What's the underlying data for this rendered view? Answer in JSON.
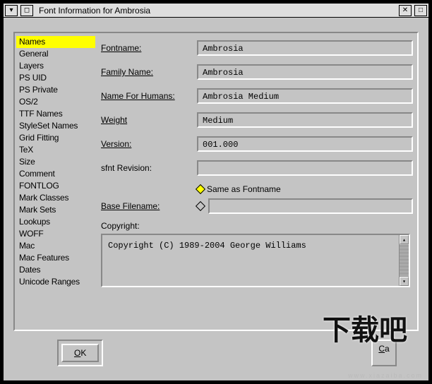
{
  "window": {
    "title": "Font Information for Ambrosia"
  },
  "sidebar": {
    "items": [
      {
        "label": "Names",
        "selected": true
      },
      {
        "label": "General"
      },
      {
        "label": "Layers"
      },
      {
        "label": "PS UID"
      },
      {
        "label": "PS Private"
      },
      {
        "label": "OS/2"
      },
      {
        "label": "TTF Names"
      },
      {
        "label": "StyleSet Names"
      },
      {
        "label": "Grid Fitting"
      },
      {
        "label": "TeX"
      },
      {
        "label": "Size"
      },
      {
        "label": "Comment"
      },
      {
        "label": "FONTLOG"
      },
      {
        "label": "Mark Classes"
      },
      {
        "label": "Mark Sets"
      },
      {
        "label": "Lookups"
      },
      {
        "label": "WOFF"
      },
      {
        "label": "Mac"
      },
      {
        "label": "Mac Features"
      },
      {
        "label": "Dates"
      },
      {
        "label": "Unicode Ranges"
      }
    ]
  },
  "form": {
    "fontname": {
      "label": "Fontname:",
      "value": "Ambrosia"
    },
    "family": {
      "label": "Family Name:",
      "value": "Ambrosia"
    },
    "humans": {
      "label": "Name For Humans:",
      "value": "Ambrosia Medium"
    },
    "weight": {
      "label": "Weight",
      "value": "Medium"
    },
    "version": {
      "label": "Version:",
      "value": "001.000"
    },
    "sfnt": {
      "label": "sfnt Revision:",
      "value": ""
    },
    "sameAsFontname": {
      "label": "Same as Fontname",
      "checked": true
    },
    "baseFilename": {
      "label": "Base Filename:",
      "value": ""
    },
    "copyright": {
      "label": "Copyright:",
      "text": "Copyright (C) 1989-2004 George Williams"
    }
  },
  "buttons": {
    "ok": "OK",
    "cancel": "Cancel"
  },
  "overlay": {
    "logo": "下载吧",
    "url": "www.xiazaiba.com"
  }
}
